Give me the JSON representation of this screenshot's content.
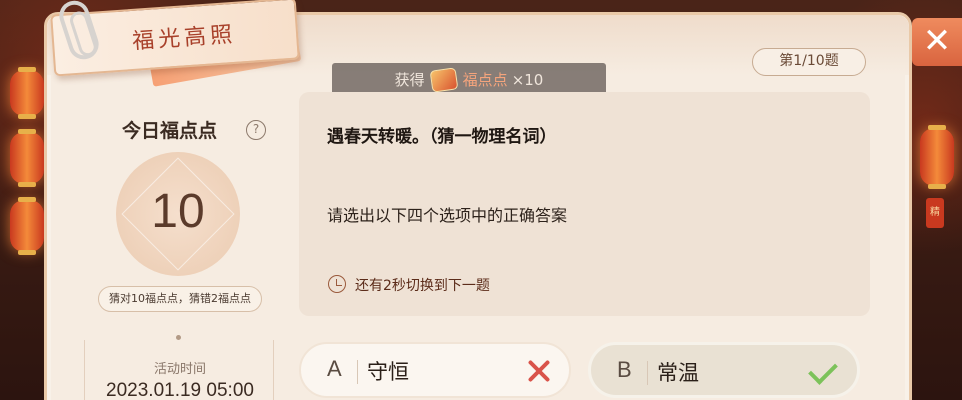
{
  "header": {
    "title": "福光高照",
    "close_label": "✕",
    "question_counter": "第1/10题",
    "side_tab": "精"
  },
  "reward_toast": {
    "prefix": "获得",
    "item": "福点点",
    "amount": "×10"
  },
  "points_panel": {
    "title": "今日福点点",
    "help_label": "?",
    "value": "10",
    "rule": "猜对10福点点，猜错2福点点",
    "activity_label": "活动时间",
    "activity_time": "2023.01.19 05:00"
  },
  "question": {
    "text": "遇春天转暖。（猜一物理名词）",
    "prompt": "请选出以下四个选项中的正确答案",
    "timer": "还有2秒切换到下一题"
  },
  "options": [
    {
      "letter": "A",
      "text": "守恒",
      "state": "wrong",
      "icon": "close-x-icon"
    },
    {
      "letter": "B",
      "text": "常温",
      "state": "correct",
      "icon": "check-icon"
    }
  ],
  "colors": {
    "accent": "#a8402a",
    "correct": "#7cc25a",
    "wrong": "#d9534a",
    "panel": "#f6ece1"
  }
}
